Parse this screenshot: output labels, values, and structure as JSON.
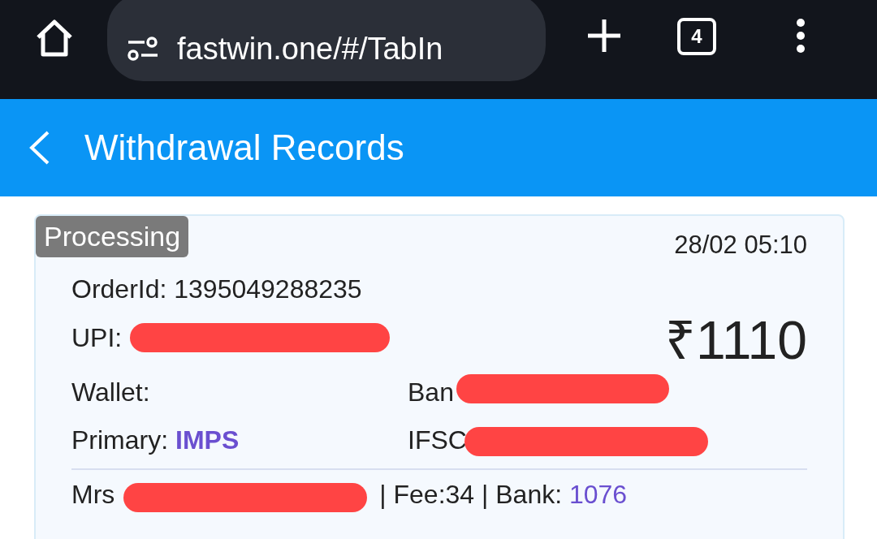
{
  "browser": {
    "url": "fastwin.one/#/TabIn",
    "tab_count": "4"
  },
  "header": {
    "title": "Withdrawal Records"
  },
  "records": [
    {
      "status": "Processing",
      "time": "28/02 05:10",
      "order_id": "OrderId: 1395049288235",
      "upi_label": "UPI:",
      "amount": "₹1110",
      "wallet_label": "Wallet:",
      "bank_label": "Ban",
      "primary_label": "Primary:",
      "primary_value": "IMPS",
      "ifsc_label": "IFSC",
      "name_label": "Mrs",
      "fee": "| Fee:34 | Bank:",
      "bank_amount": "1076"
    }
  ]
}
